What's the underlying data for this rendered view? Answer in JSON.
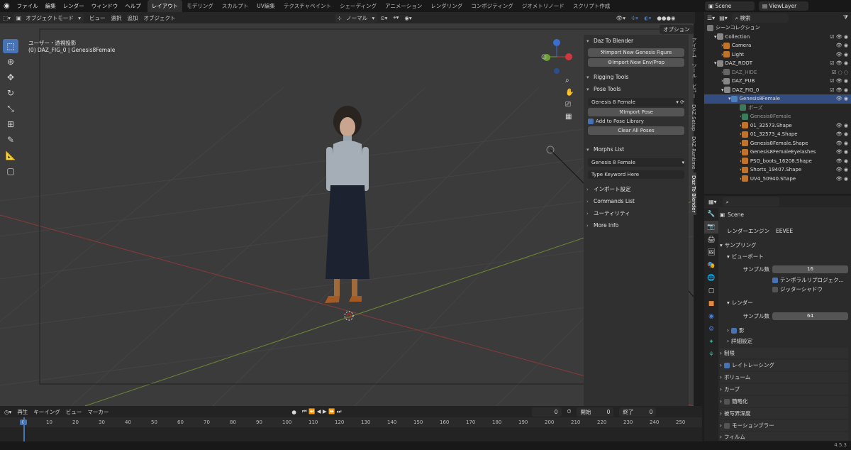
{
  "menu": {
    "items": [
      "ファイル",
      "編集",
      "レンダー",
      "ウィンドウ",
      "ヘルプ"
    ]
  },
  "workspaces": [
    "レイアウト",
    "モデリング",
    "スカルプト",
    "UV編集",
    "テクスチャペイント",
    "シェーディング",
    "アニメーション",
    "レンダリング",
    "コンポジティング",
    "ジオメトリノード",
    "スクリプト作成"
  ],
  "topright": {
    "scene": "Scene",
    "viewlayer": "ViewLayer"
  },
  "viewport_header": {
    "mode": "オブジェクトモード",
    "items": [
      "ビュー",
      "選択",
      "追加",
      "オブジェクト"
    ],
    "orientation": "ノーマル",
    "options": "オプション"
  },
  "viewport": {
    "view_label": "ユーザー・透視投影",
    "object_label": "(0) DAZ_FIG_0 | Genesis8Female"
  },
  "npanel": {
    "daz_title": "Daz To Blender",
    "import_figure": "Import New Genesis Figure",
    "import_env": "Import New Env/Prop",
    "rigging": "Rigging Tools",
    "pose_tools": "Pose Tools",
    "pose_select": "Genesis 8 Female",
    "import_pose": "Import Pose",
    "add_pose_lib": "Add to Pose Library",
    "clear_poses": "Clear All Poses",
    "morphs": "Morphs List",
    "morph_select": "Genesis 8 Female",
    "keyword_placeholder": "Type Keyword Here",
    "import_settings": "インポート設定",
    "commands": "Commands List",
    "utility": "ユーティリティ",
    "more_info": "More Info"
  },
  "vtabs": [
    "アイテム",
    "ツール",
    "ビュー",
    "DAZ Setup",
    "DAZ Runtime",
    "Daz To Blender"
  ],
  "outliner": {
    "search_placeholder": "検索",
    "rows": [
      {
        "label": "シーンコレクション",
        "indent": 0
      },
      {
        "label": "Collection",
        "indent": 1
      },
      {
        "label": "Camera",
        "indent": 2
      },
      {
        "label": "Light",
        "indent": 2
      },
      {
        "label": "DAZ_ROOT",
        "indent": 1
      },
      {
        "label": "DAZ_HIDE",
        "indent": 2
      },
      {
        "label": "DAZ_PUB",
        "indent": 2
      },
      {
        "label": "DAZ_FIG_0",
        "indent": 2
      },
      {
        "label": "Genesis8Female",
        "indent": 3
      },
      {
        "label": "ポーズ",
        "indent": 4
      },
      {
        "label": "Genesis8Female",
        "indent": 4
      },
      {
        "label": "01_32573.Shape",
        "indent": 4
      },
      {
        "label": "01_32573_4.Shape",
        "indent": 4
      },
      {
        "label": "Genesis8Female.Shape",
        "indent": 4
      },
      {
        "label": "Genesis8FemaleEyelashes",
        "indent": 4
      },
      {
        "label": "PSO_boots_16208.Shape",
        "indent": 4
      },
      {
        "label": "Shorts_19407.Shape",
        "indent": 4
      },
      {
        "label": "UV4_50940.Shape",
        "indent": 4
      }
    ]
  },
  "properties": {
    "scene": "Scene",
    "engine_label": "レンダーエンジン",
    "engine": "EEVEE",
    "sampling": "サンプリング",
    "viewport": "ビューポート",
    "samples_label": "サンプル数",
    "viewport_samples": "16",
    "temporal": "テンポラルリプロジェク...",
    "jitter": "ジッターシャドウ",
    "render": "レンダー",
    "render_samples": "64",
    "shadow": "影",
    "advanced": "詳細設定",
    "limits": "制限",
    "raytracing": "レイトレーシング",
    "volume": "ボリューム",
    "curves": "カーブ",
    "simplify": "簡略化",
    "dof": "被写界深度",
    "motion_blur": "モーションブラー",
    "film": "フィルム"
  },
  "timeline": {
    "playback": "再生",
    "keying": "キーイング",
    "view": "ビュー",
    "marker": "マーカー",
    "current": "0",
    "start_label": "開始",
    "start": "0",
    "end_label": "終了",
    "end": "0",
    "ticks": [
      "0",
      "10",
      "20",
      "30",
      "40",
      "50",
      "60",
      "70",
      "80",
      "90",
      "100",
      "110",
      "120",
      "130",
      "140",
      "150",
      "160",
      "170",
      "180",
      "190",
      "200",
      "210",
      "220",
      "230",
      "240",
      "250"
    ]
  },
  "version": "4.5.3",
  "colors": {
    "accent": "#4772b3",
    "x_axis": "#c0392b",
    "y_axis": "#7da33a"
  }
}
